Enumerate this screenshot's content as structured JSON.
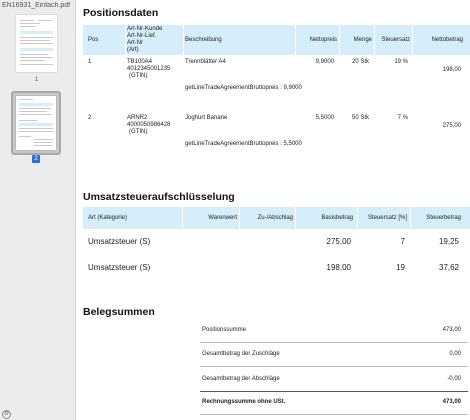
{
  "sidebar": {
    "filename": "EN16931_Einfach.pdf",
    "page1_label": "1",
    "page2_label": "2"
  },
  "positions": {
    "title": "Positionsdaten",
    "headers": {
      "pos": "Pos",
      "artnr_line1": "Art-Nr-Kunde",
      "artnr_line2": "Art-Nr-Lief.",
      "artnr_line3": "Art-Nr",
      "artnr_line4": "(Art)",
      "beschreibung": "Beschreibung",
      "nettopreis": "Nettopreis",
      "menge": "Menge",
      "steuersatz": "Steuersatz",
      "nettobetrag": "Nettobetrag"
    },
    "rows": [
      {
        "pos": "1",
        "artnr1": "TB100A4",
        "artnr2": "4012345001235",
        "artnr3": "(GTIN)",
        "beschreibung": "Trennblätter A4",
        "nettopreis": "9,9000",
        "menge": "20 Stk",
        "steuersatz": "19 %",
        "nettobetrag": "198,00",
        "detail": "getLineTradeAgreementBruttopreis : 9,9000"
      },
      {
        "pos": "2",
        "artnr1": "ARNR2",
        "artnr2": "4000050986428",
        "artnr3": "(GTIN)",
        "beschreibung": "Joghurt Banane",
        "nettopreis": "5,5000",
        "menge": "50 Stk",
        "steuersatz": "7 %",
        "nettobetrag": "275,00",
        "detail": "getLineTradeAgreementBruttopreis : 5,5000"
      }
    ]
  },
  "tax": {
    "title": "Umsatzsteueraufschlüsselung",
    "headers": {
      "art": "Art (Kategorie)",
      "warenwert": "Warenwert",
      "zuabschlag": "Zu-/Abschlag",
      "basisbetrag": "Basisbetrag",
      "steuersatz": "Steuersatz [%]",
      "steuerbetrag": "Steuerbetrag"
    },
    "rows": [
      {
        "art": "Umsatzsteuer  (S)",
        "basisbetrag": "275,00",
        "steuersatz": "7",
        "steuerbetrag": "19,25"
      },
      {
        "art": "Umsatzsteuer  (S)",
        "basisbetrag": "198,00",
        "steuersatz": "19",
        "steuerbetrag": "37,62"
      }
    ]
  },
  "totals": {
    "title": "Belegsummen",
    "rows": [
      {
        "label": "Positionssumme",
        "value": "473,00"
      },
      {
        "label": "Gesamtbetrag der Zuschläge",
        "value": "0,00"
      },
      {
        "label": "Gesamtbetrag der Abschläge",
        "value": "-0,00"
      },
      {
        "label": "Rechnungssumme ohne USt.",
        "value": "473,00"
      }
    ]
  },
  "colors": {
    "header_bg": "#d6eef9",
    "selection": "#2f6fd6"
  }
}
